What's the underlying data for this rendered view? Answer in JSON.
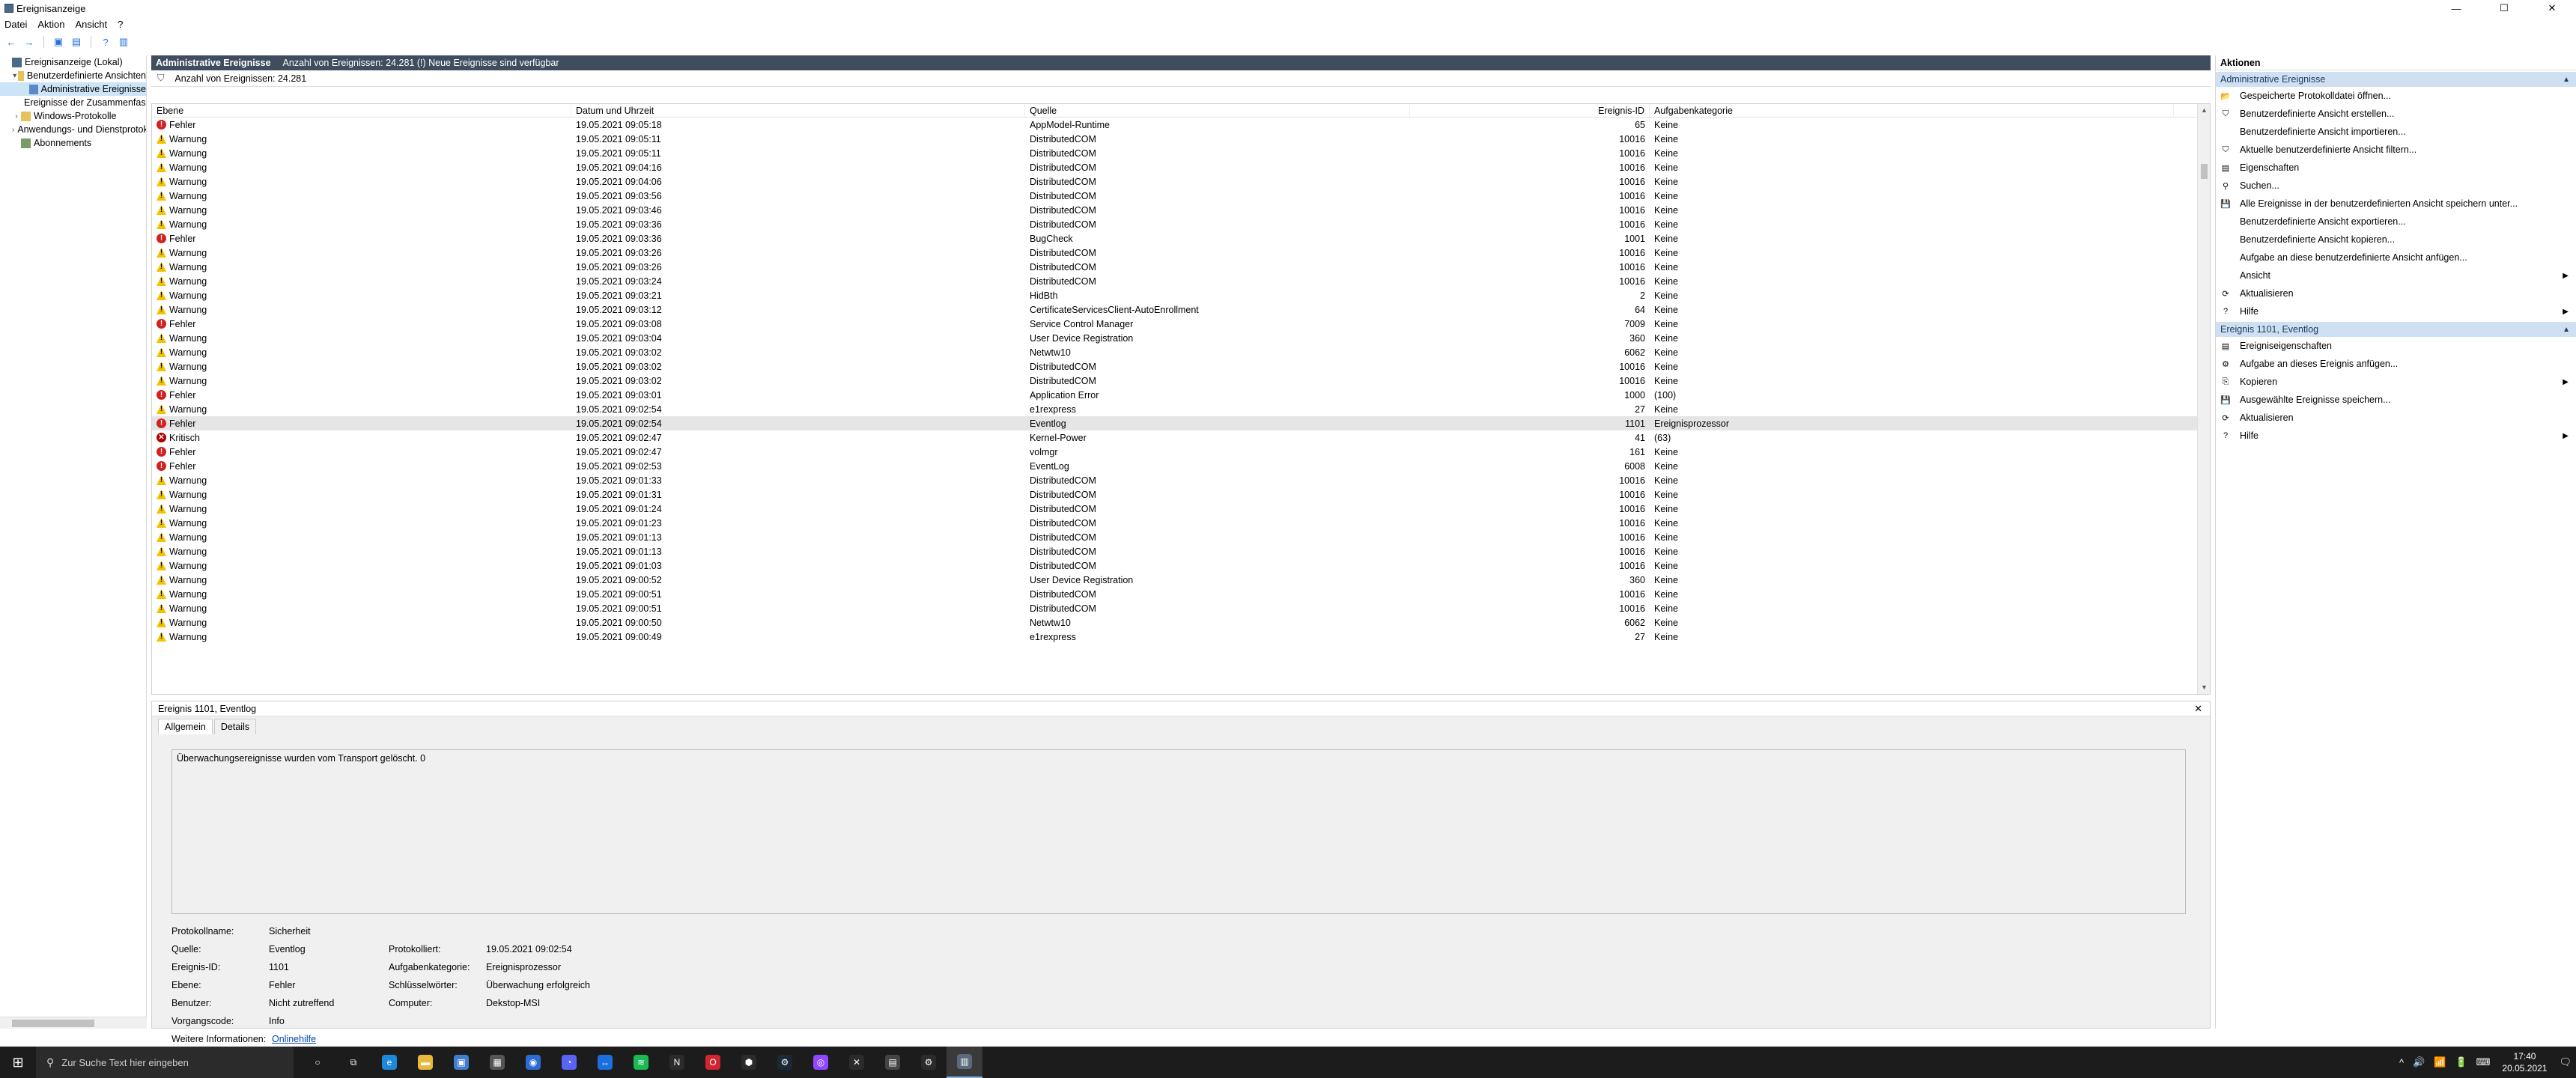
{
  "window": {
    "title": "Ereignisanzeige",
    "min": "—",
    "max": "☐",
    "close": "✕"
  },
  "menu": [
    "Datei",
    "Aktion",
    "Ansicht",
    "?"
  ],
  "tree": {
    "items": [
      {
        "label": "Ereignisanzeige (Lokal)",
        "indent": 0,
        "expander": "",
        "icon": "event-viewer-icon",
        "selected": false
      },
      {
        "label": "Benutzerdefinierte Ansichten",
        "indent": 1,
        "expander": "▾",
        "icon": "folder-icon",
        "selected": false
      },
      {
        "label": "Administrative Ereignisse",
        "indent": 2,
        "expander": "",
        "icon": "filter-icon",
        "selected": true
      },
      {
        "label": "Ereignisse der Zusammenfassung",
        "indent": 2,
        "expander": "",
        "icon": "filter-icon",
        "selected": false
      },
      {
        "label": "Windows-Protokolle",
        "indent": 1,
        "expander": "›",
        "icon": "folder-icon",
        "selected": false
      },
      {
        "label": "Anwendungs- und Dienstprotokolle",
        "indent": 1,
        "expander": "›",
        "icon": "folder-icon",
        "selected": false
      },
      {
        "label": "Abonnements",
        "indent": 1,
        "expander": "",
        "icon": "subscription-icon",
        "selected": false
      }
    ]
  },
  "center": {
    "header_title": "Administrative Ereignisse",
    "header_info": "Anzahl von Ereignissen: 24.281 (!) Neue Ereignisse sind verfügbar",
    "filter_text": "Anzahl von Ereignissen: 24.281",
    "columns": [
      "Ebene",
      "Datum und Uhrzeit",
      "Quelle",
      "Ereignis-ID",
      "Aufgabenkategorie"
    ],
    "rows": [
      {
        "level": "Fehler",
        "sev": "err",
        "dt": "19.05.2021 09:05:18",
        "src": "AppModel-Runtime",
        "id": "65",
        "cat": "Keine"
      },
      {
        "level": "Warnung",
        "sev": "warn",
        "dt": "19.05.2021 09:05:11",
        "src": "DistributedCOM",
        "id": "10016",
        "cat": "Keine"
      },
      {
        "level": "Warnung",
        "sev": "warn",
        "dt": "19.05.2021 09:05:11",
        "src": "DistributedCOM",
        "id": "10016",
        "cat": "Keine"
      },
      {
        "level": "Warnung",
        "sev": "warn",
        "dt": "19.05.2021 09:04:16",
        "src": "DistributedCOM",
        "id": "10016",
        "cat": "Keine"
      },
      {
        "level": "Warnung",
        "sev": "warn",
        "dt": "19.05.2021 09:04:06",
        "src": "DistributedCOM",
        "id": "10016",
        "cat": "Keine"
      },
      {
        "level": "Warnung",
        "sev": "warn",
        "dt": "19.05.2021 09:03:56",
        "src": "DistributedCOM",
        "id": "10016",
        "cat": "Keine"
      },
      {
        "level": "Warnung",
        "sev": "warn",
        "dt": "19.05.2021 09:03:46",
        "src": "DistributedCOM",
        "id": "10016",
        "cat": "Keine"
      },
      {
        "level": "Warnung",
        "sev": "warn",
        "dt": "19.05.2021 09:03:36",
        "src": "DistributedCOM",
        "id": "10016",
        "cat": "Keine"
      },
      {
        "level": "Fehler",
        "sev": "err",
        "dt": "19.05.2021 09:03:36",
        "src": "BugCheck",
        "id": "1001",
        "cat": "Keine"
      },
      {
        "level": "Warnung",
        "sev": "warn",
        "dt": "19.05.2021 09:03:26",
        "src": "DistributedCOM",
        "id": "10016",
        "cat": "Keine"
      },
      {
        "level": "Warnung",
        "sev": "warn",
        "dt": "19.05.2021 09:03:26",
        "src": "DistributedCOM",
        "id": "10016",
        "cat": "Keine"
      },
      {
        "level": "Warnung",
        "sev": "warn",
        "dt": "19.05.2021 09:03:24",
        "src": "DistributedCOM",
        "id": "10016",
        "cat": "Keine"
      },
      {
        "level": "Warnung",
        "sev": "warn",
        "dt": "19.05.2021 09:03:21",
        "src": "HidBth",
        "id": "2",
        "cat": "Keine"
      },
      {
        "level": "Warnung",
        "sev": "warn",
        "dt": "19.05.2021 09:03:12",
        "src": "CertificateServicesClient-AutoEnrollment",
        "id": "64",
        "cat": "Keine"
      },
      {
        "level": "Fehler",
        "sev": "err",
        "dt": "19.05.2021 09:03:08",
        "src": "Service Control Manager",
        "id": "7009",
        "cat": "Keine"
      },
      {
        "level": "Warnung",
        "sev": "warn",
        "dt": "19.05.2021 09:03:04",
        "src": "User Device Registration",
        "id": "360",
        "cat": "Keine"
      },
      {
        "level": "Warnung",
        "sev": "warn",
        "dt": "19.05.2021 09:03:02",
        "src": "Netwtw10",
        "id": "6062",
        "cat": "Keine"
      },
      {
        "level": "Warnung",
        "sev": "warn",
        "dt": "19.05.2021 09:03:02",
        "src": "DistributedCOM",
        "id": "10016",
        "cat": "Keine"
      },
      {
        "level": "Warnung",
        "sev": "warn",
        "dt": "19.05.2021 09:03:02",
        "src": "DistributedCOM",
        "id": "10016",
        "cat": "Keine"
      },
      {
        "level": "Fehler",
        "sev": "err",
        "dt": "19.05.2021 09:03:01",
        "src": "Application Error",
        "id": "1000",
        "cat": "(100)"
      },
      {
        "level": "Warnung",
        "sev": "warn",
        "dt": "19.05.2021 09:02:54",
        "src": "e1rexpress",
        "id": "27",
        "cat": "Keine"
      },
      {
        "level": "Fehler",
        "sev": "err",
        "dt": "19.05.2021 09:02:54",
        "src": "Eventlog",
        "id": "1101",
        "cat": "Ereignisprozessor",
        "selected": true
      },
      {
        "level": "Kritisch",
        "sev": "crit",
        "dt": "19.05.2021 09:02:47",
        "src": "Kernel-Power",
        "id": "41",
        "cat": "(63)"
      },
      {
        "level": "Fehler",
        "sev": "err",
        "dt": "19.05.2021 09:02:47",
        "src": "volmgr",
        "id": "161",
        "cat": "Keine"
      },
      {
        "level": "Fehler",
        "sev": "err",
        "dt": "19.05.2021 09:02:53",
        "src": "EventLog",
        "id": "6008",
        "cat": "Keine"
      },
      {
        "level": "Warnung",
        "sev": "warn",
        "dt": "19.05.2021 09:01:33",
        "src": "DistributedCOM",
        "id": "10016",
        "cat": "Keine"
      },
      {
        "level": "Warnung",
        "sev": "warn",
        "dt": "19.05.2021 09:01:31",
        "src": "DistributedCOM",
        "id": "10016",
        "cat": "Keine"
      },
      {
        "level": "Warnung",
        "sev": "warn",
        "dt": "19.05.2021 09:01:24",
        "src": "DistributedCOM",
        "id": "10016",
        "cat": "Keine"
      },
      {
        "level": "Warnung",
        "sev": "warn",
        "dt": "19.05.2021 09:01:23",
        "src": "DistributedCOM",
        "id": "10016",
        "cat": "Keine"
      },
      {
        "level": "Warnung",
        "sev": "warn",
        "dt": "19.05.2021 09:01:13",
        "src": "DistributedCOM",
        "id": "10016",
        "cat": "Keine"
      },
      {
        "level": "Warnung",
        "sev": "warn",
        "dt": "19.05.2021 09:01:13",
        "src": "DistributedCOM",
        "id": "10016",
        "cat": "Keine"
      },
      {
        "level": "Warnung",
        "sev": "warn",
        "dt": "19.05.2021 09:01:03",
        "src": "DistributedCOM",
        "id": "10016",
        "cat": "Keine"
      },
      {
        "level": "Warnung",
        "sev": "warn",
        "dt": "19.05.2021 09:00:52",
        "src": "User Device Registration",
        "id": "360",
        "cat": "Keine"
      },
      {
        "level": "Warnung",
        "sev": "warn",
        "dt": "19.05.2021 09:00:51",
        "src": "DistributedCOM",
        "id": "10016",
        "cat": "Keine"
      },
      {
        "level": "Warnung",
        "sev": "warn",
        "dt": "19.05.2021 09:00:51",
        "src": "DistributedCOM",
        "id": "10016",
        "cat": "Keine"
      },
      {
        "level": "Warnung",
        "sev": "warn",
        "dt": "19.05.2021 09:00:50",
        "src": "Netwtw10",
        "id": "6062",
        "cat": "Keine"
      },
      {
        "level": "Warnung",
        "sev": "warn",
        "dt": "19.05.2021 09:00:49",
        "src": "e1rexpress",
        "id": "27",
        "cat": "Keine"
      }
    ]
  },
  "detail": {
    "title": "Ereignis 1101, Eventlog",
    "close": "✕",
    "tabs": [
      "Allgemein",
      "Details"
    ],
    "message": "Überwachungsereignisse wurden vom Transport gelöscht. 0",
    "props": {
      "protokollname_label": "Protokollname:",
      "protokollname": "Sicherheit",
      "quelle_label": "Quelle:",
      "quelle": "Eventlog",
      "protokolliert_label": "Protokolliert:",
      "protokolliert": "19.05.2021 09:02:54",
      "ereignisid_label": "Ereignis-ID:",
      "ereignisid": "1101",
      "aufgabe_label": "Aufgabenkategorie:",
      "aufgabe": "Ereignisprozessor",
      "ebene_label": "Ebene:",
      "ebene": "Fehler",
      "schluessel_label": "Schlüsselwörter:",
      "schluessel": "Überwachung erfolgreich",
      "benutzer_label": "Benutzer:",
      "benutzer": "Nicht zutreffend",
      "computer_label": "Computer:",
      "computer": "Dekstop-MSI",
      "vorgang_label": "Vorgangscode:",
      "vorgang": "Info",
      "weitere_label": "Weitere Informationen:",
      "weitere_link": "Onlinehilfe"
    }
  },
  "actions": {
    "title": "Aktionen",
    "section1": "Administrative Ereignisse",
    "items1": [
      {
        "label": "Gespeicherte Protokolldatei öffnen...",
        "icon": "open-folder-icon",
        "glyph": "📂",
        "sub": false
      },
      {
        "label": "Benutzerdefinierte Ansicht erstellen...",
        "icon": "create-filter-icon",
        "glyph": "⛉",
        "sub": false
      },
      {
        "label": "Benutzerdefinierte Ansicht importieren...",
        "icon": "",
        "glyph": "",
        "sub": false
      },
      {
        "label": "Aktuelle benutzerdefinierte Ansicht filtern...",
        "icon": "filter-icon",
        "glyph": "⛉",
        "sub": false
      },
      {
        "label": "Eigenschaften",
        "icon": "properties-icon",
        "glyph": "▤",
        "sub": false
      },
      {
        "label": "Suchen...",
        "icon": "find-icon",
        "glyph": "⚲",
        "sub": false
      },
      {
        "label": "Alle Ereignisse in der benutzerdefinierten Ansicht speichern unter...",
        "icon": "save-icon",
        "glyph": "💾",
        "sub": false
      },
      {
        "label": "Benutzerdefinierte Ansicht exportieren...",
        "icon": "",
        "glyph": "",
        "sub": false
      },
      {
        "label": "Benutzerdefinierte Ansicht kopieren...",
        "icon": "",
        "glyph": "",
        "sub": false
      },
      {
        "label": "Aufgabe an diese benutzerdefinierte Ansicht anfügen...",
        "icon": "",
        "glyph": "",
        "sub": false
      },
      {
        "label": "Ansicht",
        "icon": "",
        "glyph": "",
        "sub": true
      },
      {
        "label": "Aktualisieren",
        "icon": "refresh-icon",
        "glyph": "⟳",
        "sub": false
      },
      {
        "label": "Hilfe",
        "icon": "help-icon",
        "glyph": "?",
        "sub": true
      }
    ],
    "section2": "Ereignis 1101, Eventlog",
    "items2": [
      {
        "label": "Ereigniseigenschaften",
        "icon": "properties-icon",
        "glyph": "▤",
        "sub": false
      },
      {
        "label": "Aufgabe an dieses Ereignis anfügen...",
        "icon": "task-icon",
        "glyph": "⚙",
        "sub": false
      },
      {
        "label": "Kopieren",
        "icon": "copy-icon",
        "glyph": "⎘",
        "sub": true
      },
      {
        "label": "Ausgewählte Ereignisse speichern...",
        "icon": "save-icon",
        "glyph": "💾",
        "sub": false
      },
      {
        "label": "Aktualisieren",
        "icon": "refresh-icon",
        "glyph": "⟳",
        "sub": false
      },
      {
        "label": "Hilfe",
        "icon": "help-icon",
        "glyph": "?",
        "sub": true
      }
    ]
  },
  "taskbar": {
    "search_placeholder": "Zur Suche Text hier eingeben",
    "time": "17:40",
    "date": "20.05.2021",
    "apps": [
      {
        "name": "cortana-icon",
        "glyph": "○",
        "color": "#1c1c1c"
      },
      {
        "name": "task-view-icon",
        "glyph": "⧉",
        "color": "#1c1c1c"
      },
      {
        "name": "edge-icon",
        "glyph": "e",
        "color": "#1f88d9"
      },
      {
        "name": "file-explorer-icon",
        "glyph": "▬",
        "color": "#e8b93a"
      },
      {
        "name": "store-icon",
        "glyph": "▣",
        "color": "#3f7fd1"
      },
      {
        "name": "calculator-icon",
        "glyph": "▦",
        "color": "#555555"
      },
      {
        "name": "app-blue-icon",
        "glyph": "◉",
        "color": "#2d6bd4"
      },
      {
        "name": "discord-icon",
        "glyph": "◔",
        "color": "#5865f2"
      },
      {
        "name": "teamviewer-icon",
        "glyph": "↔",
        "color": "#1d6fe0"
      },
      {
        "name": "spotify-icon",
        "glyph": "≋",
        "color": "#1db954"
      },
      {
        "name": "notion-icon",
        "glyph": "N",
        "color": "#2b2b2b"
      },
      {
        "name": "opera-icon",
        "glyph": "O",
        "color": "#d1262f"
      },
      {
        "name": "app-white-icon",
        "glyph": "⬢",
        "color": "#2b2b2b"
      },
      {
        "name": "steam-icon",
        "glyph": "⚙",
        "color": "#1b2838"
      },
      {
        "name": "twitch-icon",
        "glyph": "◎",
        "color": "#9146ff"
      },
      {
        "name": "xbox-icon",
        "glyph": "✕",
        "color": "#2b2b2b"
      },
      {
        "name": "notes-icon",
        "glyph": "▤",
        "color": "#444444"
      },
      {
        "name": "settings-icon",
        "glyph": "⚙",
        "color": "#2b2b2b"
      },
      {
        "name": "event-viewer-task-icon",
        "glyph": "▥",
        "color": "#5a6a7a"
      }
    ],
    "tray": [
      "^",
      "🔊",
      "📶",
      "🔋",
      "⌨"
    ],
    "notification": "🗨"
  },
  "toolbar": {
    "back": "←",
    "forward": "→",
    "up": "▣",
    "props": "▤",
    "help": "?",
    "view": "▥"
  }
}
